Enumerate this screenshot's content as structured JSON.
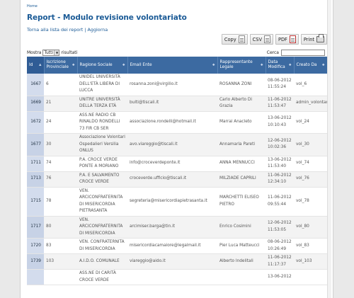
{
  "breadcrumb": "Home",
  "title": "Report - Modulo revisione volontariato",
  "sublinks": {
    "back": "Torna alla lista dei report",
    "sep": " | ",
    "refresh": "Aggiorna"
  },
  "toolbar": {
    "copy": "Copy",
    "csv": "CSV",
    "pdf": "PDF",
    "print": "Print"
  },
  "controls": {
    "show_prefix": "Mostra",
    "show_value": "Tutti",
    "show_suffix": "risultati",
    "search_label": "Cerca"
  },
  "table": {
    "headers": [
      "Id",
      "Iscrizione Provinciale",
      "Ragione Sociale",
      "Email Ente",
      "Rappresentante Legale",
      "Data Modifica",
      "Creato Da"
    ],
    "rows": [
      {
        "id": "1667",
        "isc": "6",
        "ragione": "UNIDEL UNIVERSITÀ DELL'ETÀ LIBERA DI LUCCA",
        "email": "rosanna.zoni@virgilio.it",
        "rapp": "ROSANNA ZONI",
        "data": "08-06-2012 11:55:24",
        "creato": "vol_6"
      },
      {
        "id": "1669",
        "isc": "21",
        "ragione": "UNITRE UNIVERSITÀ DELLA TERZA ETÀ",
        "email": "bulti@tiscali.it",
        "rapp": "Carlo Alberto Di Grazia",
        "data": "11-06-2012 11:53:47",
        "creato": "admin_volontariato"
      },
      {
        "id": "1672",
        "isc": "24",
        "ragione": "ASS.NE RADIO CB RINALDO RONDELLI 73 FIR CB SER",
        "email": "associazione.rondelli@hotmail.it",
        "rapp": "Marrai Anacleto",
        "data": "13-06-2012 10:10:43",
        "creato": "vol_24"
      },
      {
        "id": "1677",
        "isc": "30",
        "ragione": "Associazione Volontari Ospedalieri Versilia ONLUS",
        "email": "avo.viareggio@tiscali.it",
        "rapp": "Annamaria Pareti",
        "data": "12-06-2012 10:02:36",
        "creato": "vol_30"
      },
      {
        "id": "1711",
        "isc": "74",
        "ragione": "P.A. CROCE VERDE PONTE A MORIANO",
        "email": "info@croceverdeponte.it",
        "rapp": "ANNA MENNUCCI",
        "data": "13-06-2012 11:53:40",
        "creato": "vol_74"
      },
      {
        "id": "1713",
        "isc": "76",
        "ragione": "P.A. E SALVAMENTO CROCE VERDE",
        "email": "croceverde.ufficio@tiscali.it",
        "rapp": "MILZIADE CAPRILI",
        "data": "11-06-2012 12:34:10",
        "creato": "vol_76"
      },
      {
        "id": "1715",
        "isc": "78",
        "ragione": "VEN. ARCICONFRATERNITA DI MISERICORDIA PIETRASANTA",
        "email": "segreteria@misericordiapietrasanta.it",
        "rapp": "MARCHETTI ELISEO PIETRO",
        "data": "11-06-2012 09:55:44",
        "creato": "vol_78"
      },
      {
        "id": "1717",
        "isc": "80",
        "ragione": "VEN. ARCICONFRATERNITA DI MISERICORDIA",
        "email": "arcimiser.barga@tin.it",
        "rapp": "Enrico Cosimini",
        "data": "12-06-2012 11:53:05",
        "creato": "vol_80"
      },
      {
        "id": "1720",
        "isc": "83",
        "ragione": "VEN. CONFRATERNITA DI MISERICORDIA",
        "email": "misericordiacamaiore@legalmail.it",
        "rapp": "Pier Luca Matteucci",
        "data": "08-06-2012 10:26:49",
        "creato": "vol_83"
      },
      {
        "id": "1739",
        "isc": "103",
        "ragione": "A.I.D.O. COMUNALE",
        "email": "viareggio@aido.it",
        "rapp": "Alberto Indelitali",
        "data": "11-06-2012 11:17:37",
        "creato": "vol_103"
      },
      {
        "id": "",
        "isc": "",
        "ragione": "ASS.NE DI CARITÀ CROCE VERDE",
        "email": "",
        "rapp": "",
        "data": "13-06-2012",
        "creato": ""
      }
    ]
  }
}
